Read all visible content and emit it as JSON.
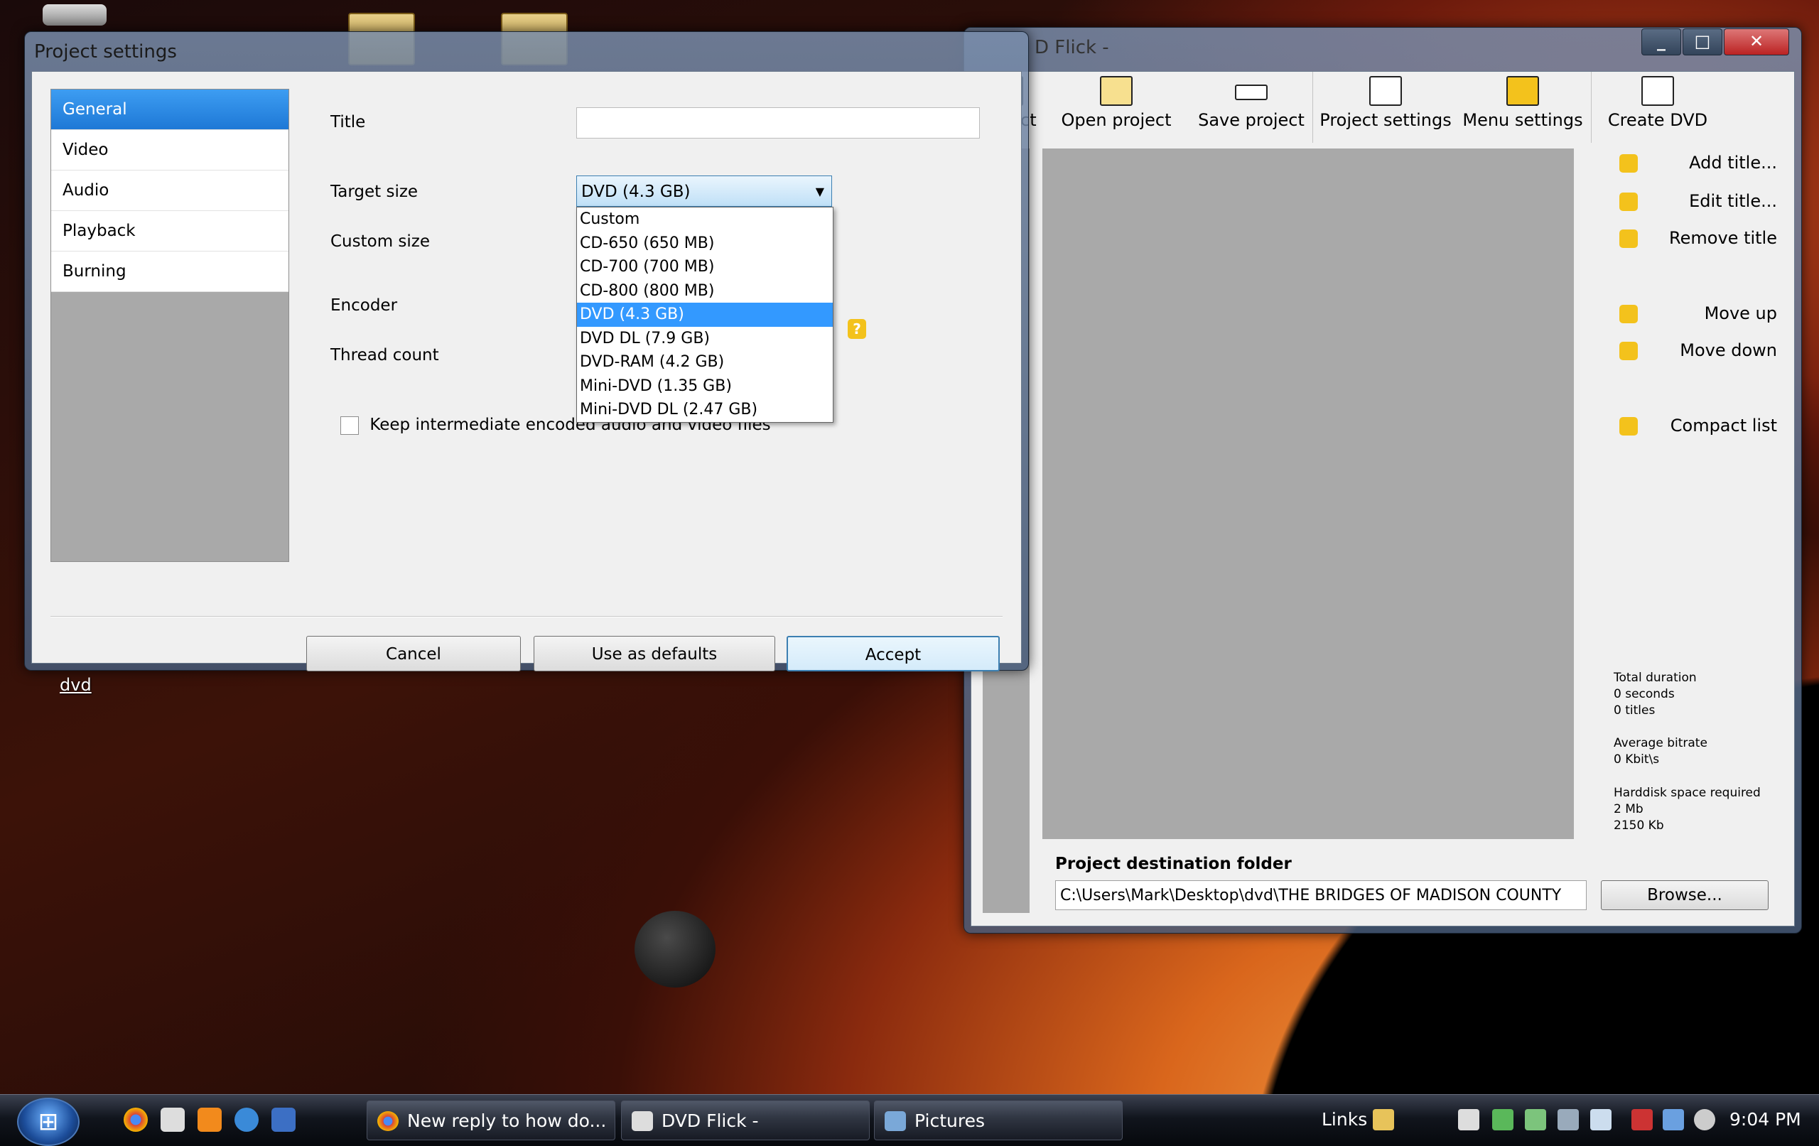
{
  "desktop": {
    "icon_label": "dvd"
  },
  "project_settings": {
    "title": "Project settings",
    "categories": [
      "General",
      "Video",
      "Audio",
      "Playback",
      "Burning"
    ],
    "fields": {
      "title_label": "Title",
      "title_value": "",
      "target_size_label": "Target size",
      "target_size_value": "DVD (4.3 GB)",
      "custom_size_label": "Custom size",
      "encoder_label": "Encoder",
      "thread_count_label": "Thread count",
      "keep_intermediate_label": "Keep intermediate encoded audio and video files"
    },
    "target_size_options": [
      "Custom",
      "CD-650 (650 MB)",
      "CD-700 (700 MB)",
      "CD-800 (800 MB)",
      "DVD (4.3 GB)",
      "DVD DL (7.9 GB)",
      "DVD-RAM (4.2 GB)",
      "Mini-DVD (1.35 GB)",
      "Mini-DVD DL (2.47 GB)"
    ],
    "selected_option": "DVD (4.3 GB)",
    "buttons": {
      "cancel": "Cancel",
      "use_as_defaults": "Use as defaults",
      "accept": "Accept"
    }
  },
  "dvd_flick": {
    "title": "D Flick -",
    "window_controls": [
      "_",
      "□",
      "✕"
    ],
    "toolbar": [
      "project",
      "Open project",
      "Save project",
      "Project settings",
      "Menu settings",
      "Create DVD"
    ],
    "side_buttons": [
      "Add title...",
      "Edit title...",
      "Remove title",
      "Move up",
      "Move down",
      "Compact list"
    ],
    "stats": {
      "total_duration_label": "Total duration",
      "total_duration_value": "0 seconds",
      "titles_value": "0 titles",
      "average_bitrate_label": "Average bitrate",
      "average_bitrate_value": "0 Kbit\\s",
      "harddisk_label": "Harddisk space required",
      "harddisk_mb": "2 Mb",
      "harddisk_kb": "2150 Kb"
    },
    "destination_label": "Project destination folder",
    "destination_path": "C:\\Users\\Mark\\Desktop\\dvd\\THE BRIDGES OF MADISON COUNTY",
    "browse": "Browse..."
  },
  "taskbar": {
    "tasks": [
      "New reply to how do...",
      "DVD Flick -",
      "Pictures"
    ],
    "links": "Links",
    "clock": "9:04 PM"
  }
}
